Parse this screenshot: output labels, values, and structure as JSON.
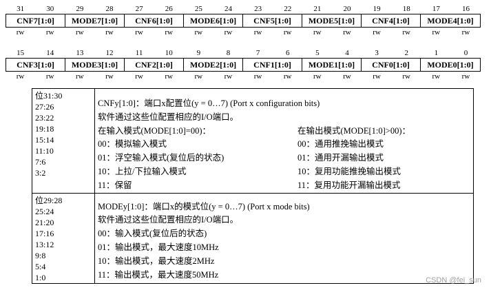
{
  "register_high": {
    "bit_numbers": [
      "31",
      "30",
      "29",
      "28",
      "27",
      "26",
      "25",
      "24",
      "23",
      "22",
      "21",
      "20",
      "19",
      "18",
      "17",
      "16"
    ],
    "fields": [
      "CNF7[1:0]",
      "MODE7[1:0]",
      "CNF6[1:0]",
      "MODE6[1:0]",
      "CNF5[1:0]",
      "MODE5[1:0]",
      "CNF4[1:0]",
      "MODE4[1:0]"
    ],
    "access": [
      "rw",
      "rw",
      "rw",
      "rw",
      "rw",
      "rw",
      "rw",
      "rw",
      "rw",
      "rw",
      "rw",
      "rw",
      "rw",
      "rw",
      "rw",
      "rw"
    ]
  },
  "register_low": {
    "bit_numbers": [
      "15",
      "14",
      "13",
      "12",
      "11",
      "10",
      "9",
      "8",
      "7",
      "6",
      "5",
      "4",
      "3",
      "2",
      "1",
      "0"
    ],
    "fields": [
      "CNF3[1:0]",
      "MODE3[1:0]",
      "CNF2[1:0]",
      "MODE2[1:0]",
      "CNF1[1:0]",
      "MODE1[1:0]",
      "CNF0[1:0]",
      "MODE0[1:0]"
    ],
    "access": [
      "rw",
      "rw",
      "rw",
      "rw",
      "rw",
      "rw",
      "rw",
      "rw",
      "rw",
      "rw",
      "rw",
      "rw",
      "rw",
      "rw",
      "rw",
      "rw"
    ]
  },
  "cnf_row": {
    "bits": [
      "位31:30",
      "27:26",
      "23:22",
      "19:18",
      "15:14",
      "11:10",
      "7:6",
      "3:2"
    ],
    "title": "CNFy[1:0]：端口x配置位(y = 0…7) (Port x configuration bits)",
    "subtitle": "软件通过这些位配置相应的I/O端口。",
    "input_header": "在输入模式(MODE[1:0]=00)：",
    "output_header": "在输出模式(MODE[1:0]>00)：",
    "input_items": [
      "00：模拟输入模式",
      "01：浮空输入模式(复位后的状态)",
      "10：上拉/下拉输入模式",
      "11：保留"
    ],
    "output_items": [
      "00：通用推挽输出模式",
      "01：通用开漏输出模式",
      "10：复用功能推挽输出模式",
      "11：复用功能开漏输出模式"
    ]
  },
  "mode_row": {
    "bits": [
      "位29:28",
      "25:24",
      "21:20",
      "17:16",
      "13:12",
      "9:8",
      "5:4",
      "1:0"
    ],
    "title": "MODEy[1:0]：端口x的模式位(y = 0…7) (Port x mode bits)",
    "subtitle": "软件通过这些位配置相应的I/O端口。",
    "items": [
      "00：输入模式(复位后的状态)",
      "01：输出模式，最大速度10MHz",
      "10：输出模式，最大速度2MHz",
      "11：输出模式，最大速度50MHz"
    ]
  },
  "watermark": "CSDN @fei_sun"
}
